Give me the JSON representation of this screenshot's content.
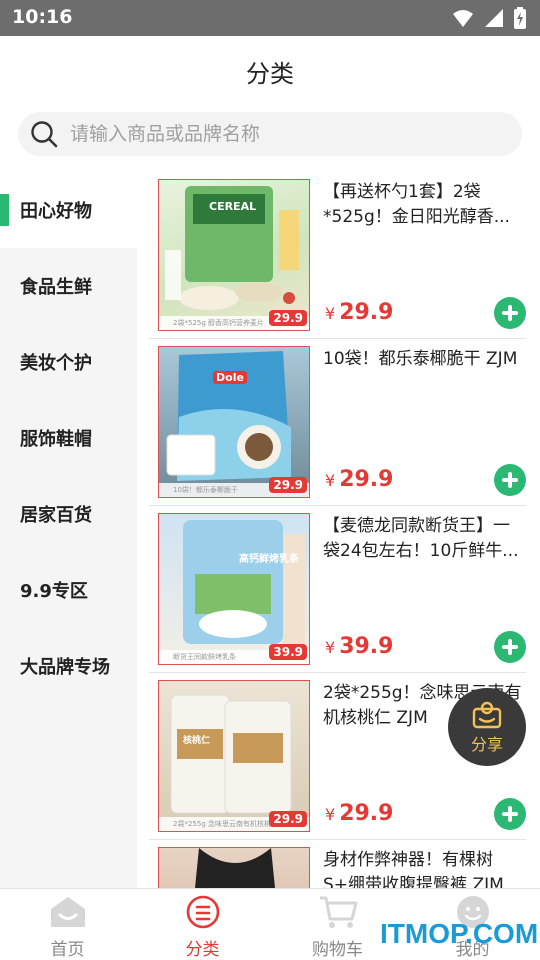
{
  "status_bar": {
    "time": "10:16"
  },
  "header": {
    "title": "分类"
  },
  "search": {
    "placeholder": "请输入商品或品牌名称"
  },
  "sidebar": {
    "items": [
      {
        "label": "田心好物",
        "active": true
      },
      {
        "label": "食品生鲜",
        "active": false
      },
      {
        "label": "美妆个护",
        "active": false
      },
      {
        "label": "服饰鞋帽",
        "active": false
      },
      {
        "label": "居家百货",
        "active": false
      },
      {
        "label": "9.9专区",
        "active": false
      },
      {
        "label": "大品牌专场",
        "active": false
      }
    ]
  },
  "products": [
    {
      "title": "【再送杯勺1套】2袋*525g！金日阳光醇香...",
      "currency": "¥",
      "price": "29.9",
      "thumb_price": "29.9",
      "thumb_caption": "2袋*525g 醇香高钙营养麦片",
      "thumb_text": "CEREAL"
    },
    {
      "title": "10袋！都乐泰椰脆干 ZJM",
      "currency": "¥",
      "price": "29.9",
      "thumb_price": "29.9",
      "thumb_caption": "10袋！都乐泰椰脆干",
      "thumb_text": "Dole"
    },
    {
      "title": "【麦德龙同款断货王】一袋24包左右！10斤鲜牛...",
      "currency": "¥",
      "price": "39.9",
      "thumb_price": "39.9",
      "thumb_caption": "断货王同款鲜烤乳条",
      "thumb_text": "高钙鲜烤乳条"
    },
    {
      "title": "2袋*255g！念味思云南有机核桃仁 ZJM",
      "currency": "¥",
      "price": "29.9",
      "thumb_price": "29.9",
      "thumb_caption": "2袋*255g 念味思云南有机核桃仁",
      "thumb_text": "核桃仁"
    },
    {
      "title": "身材作弊神器！有棵树S+绷带收腹提臀裤 ZJM",
      "currency": "¥",
      "price": "",
      "thumb_price": "",
      "thumb_caption": "",
      "thumb_text": ""
    }
  ],
  "share_button": {
    "label": "分享"
  },
  "tabbar": {
    "tabs": [
      {
        "label": "首页",
        "icon": "home-icon",
        "active": false
      },
      {
        "label": "分类",
        "icon": "category-icon",
        "active": true
      },
      {
        "label": "购物车",
        "icon": "cart-icon",
        "active": false
      },
      {
        "label": "我的",
        "icon": "profile-icon",
        "active": false
      }
    ]
  },
  "watermark": {
    "text": "ITMOP.COM"
  },
  "colors": {
    "accent_green": "#2bb873",
    "price_red": "#e53935",
    "status_bar": "#6d6d6d"
  }
}
